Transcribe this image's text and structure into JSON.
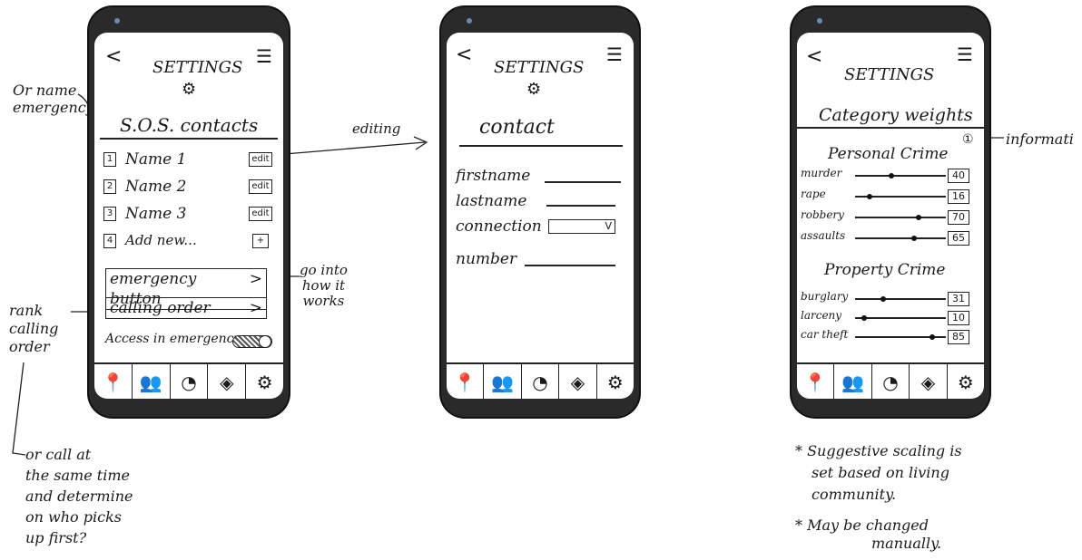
{
  "annotations": {
    "or_name_emergency": [
      "Or name",
      "emergency"
    ],
    "editing": "editing",
    "go_into": [
      "go into",
      "how it",
      "works"
    ],
    "rank_calling": [
      "rank",
      "calling",
      "order"
    ],
    "or_call": [
      "or call at",
      "the same time",
      "and determine",
      "on who picks",
      "up first?"
    ],
    "information": "informati",
    "suggestive": [
      "* Suggestive scaling is",
      "set based on living",
      "community."
    ],
    "may_be_changed": [
      "* May be changed",
      "manually."
    ],
    "info_icon": "①"
  },
  "phone1": {
    "back": "<",
    "menu": "☰",
    "title": "SETTINGS",
    "heading": "S.O.S. contacts",
    "contacts": [
      {
        "num": "1",
        "name": "Name 1",
        "action": "edit"
      },
      {
        "num": "2",
        "name": "Name 2",
        "action": "edit"
      },
      {
        "num": "3",
        "name": "Name 3",
        "action": "edit"
      }
    ],
    "add": {
      "num": "4",
      "label": "Add new...",
      "action": "+"
    },
    "emergency_button": "emergency button",
    "calling_order": "calling order",
    "chevron": ">",
    "access_label": "Access in emergency"
  },
  "phone2": {
    "back": "<",
    "menu": "☰",
    "title": "SETTINGS",
    "heading": "contact",
    "fields": [
      "firstname",
      "lastname",
      "connection",
      "number"
    ],
    "dropdown_chevron": "V"
  },
  "phone3": {
    "back": "<",
    "menu": "☰",
    "title": "SETTINGS",
    "heading": "Category weights",
    "personal_title": "Personal Crime",
    "personal": [
      {
        "label": "murder",
        "value": 40
      },
      {
        "label": "rape",
        "value": 16
      },
      {
        "label": "robbery",
        "value": 70
      },
      {
        "label": "assaults",
        "value": 65
      }
    ],
    "property_title": "Property Crime",
    "property": [
      {
        "label": "burglary",
        "value": 31
      },
      {
        "label": "larceny",
        "value": 10
      },
      {
        "label": "car theft",
        "value": 85
      }
    ]
  },
  "nav_icons": [
    "map-pin-icon",
    "people-icon",
    "compass-icon",
    "diamond-icon",
    "gear-icon"
  ]
}
